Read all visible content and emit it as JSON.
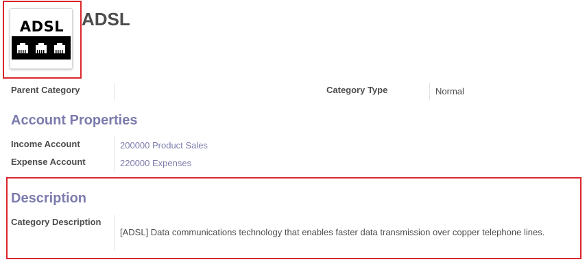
{
  "record": {
    "title": "ADSL",
    "image": {
      "logo_text": "ADSL",
      "icon": "ethernet-ports-logo"
    }
  },
  "fields": {
    "parent_category": {
      "label": "Parent Category",
      "value": ""
    },
    "category_type": {
      "label": "Category Type",
      "value": "Normal"
    }
  },
  "account_properties": {
    "title": "Account Properties",
    "income_account": {
      "label": "Income Account",
      "value": "200000 Product Sales"
    },
    "expense_account": {
      "label": "Expense Account",
      "value": "220000 Expenses"
    }
  },
  "description": {
    "title": "Description",
    "category_description": {
      "label": "Category Description",
      "value": "[ADSL] Data communications technology that enables faster data transmission over copper telephone lines."
    }
  },
  "colors": {
    "section_title": "#7c7bad",
    "link": "#7c7bad",
    "highlight": "#d9262b"
  }
}
